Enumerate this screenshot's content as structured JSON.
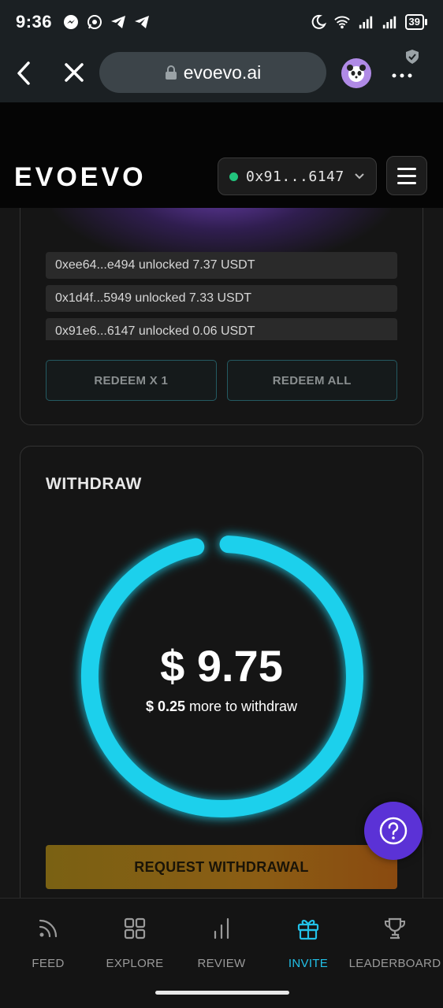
{
  "status_bar": {
    "time": "9:36",
    "battery": "39"
  },
  "browser": {
    "url": "evoevo.ai"
  },
  "app_header": {
    "logo_text": "EVOEVO",
    "wallet_address": "0x91...6147",
    "wallet_status_color": "#22c47d"
  },
  "unlock_feed": {
    "items": [
      "0xee64...e494 unlocked 7.37 USDT",
      "0x1d4f...5949 unlocked 7.33 USDT",
      "0x91e6...6147 unlocked 0.06 USDT"
    ],
    "redeem_one_label": "REDEEM X 1",
    "redeem_all_label": "REDEEM ALL"
  },
  "withdraw": {
    "title": "WITHDRAW",
    "amount": "$ 9.75",
    "remaining_value": "$ 0.25",
    "remaining_text": " more to withdraw",
    "progress_fraction": 0.975,
    "ring_color": "#1fd0ec",
    "button_label": "REQUEST WITHDRAWAL"
  },
  "bottom_nav": {
    "items": [
      {
        "label": "FEED",
        "icon": "rss-icon",
        "active": false
      },
      {
        "label": "EXPLORE",
        "icon": "grid-icon",
        "active": false
      },
      {
        "label": "REVIEW",
        "icon": "bar-chart-icon",
        "active": false
      },
      {
        "label": "INVITE",
        "icon": "gift-icon",
        "active": true
      },
      {
        "label": "LEADERBOARD",
        "icon": "trophy-icon",
        "active": false
      }
    ],
    "active_color": "#22c1e8"
  }
}
